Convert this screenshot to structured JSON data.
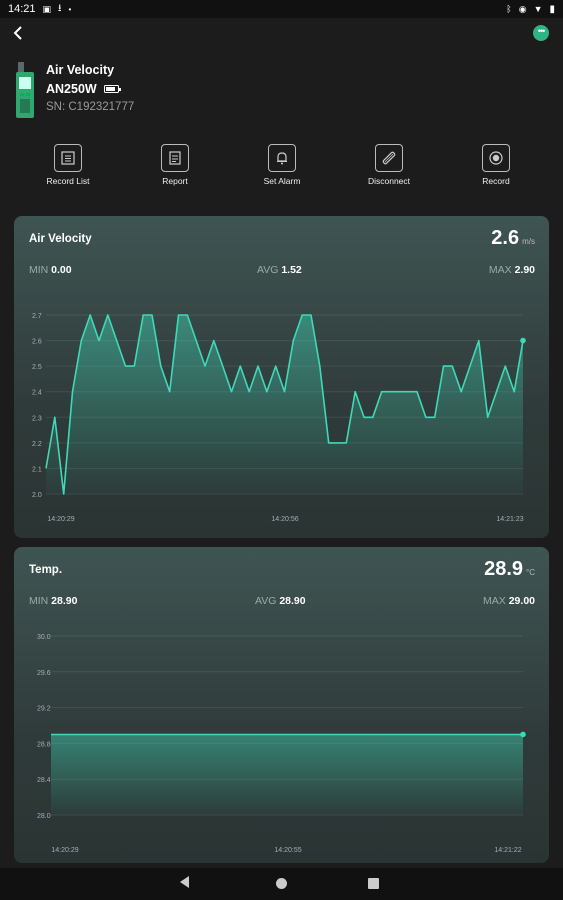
{
  "status_bar": {
    "time": "14:21"
  },
  "device": {
    "name": "Air Velocity",
    "model": "AN250W",
    "serial": "SN: C192321777"
  },
  "actions": [
    {
      "label": "Record List",
      "icon": "record-list-icon"
    },
    {
      "label": "Report",
      "icon": "report-icon"
    },
    {
      "label": "Set Alarm",
      "icon": "bell-icon"
    },
    {
      "label": "Disconnect",
      "icon": "disconnect-icon"
    },
    {
      "label": "Record",
      "icon": "record-icon"
    }
  ],
  "colors": {
    "accent": "#3fd9b8",
    "background": "#1c1c1c",
    "card": "#3a4b4a"
  },
  "cards": {
    "air": {
      "title": "Air Velocity",
      "value": "2.6",
      "unit": "m/s",
      "min_label": "MIN",
      "min": "0.00",
      "avg_label": "AVG",
      "avg": "1.52",
      "max_label": "MAX",
      "max": "2.90"
    },
    "temp": {
      "title": "Temp.",
      "value": "28.9",
      "unit": "°C",
      "min_label": "MIN",
      "min": "28.90",
      "avg_label": "AVG",
      "avg": "28.90",
      "max_label": "MAX",
      "max": "29.00"
    }
  },
  "chart_data": [
    {
      "type": "area",
      "title": "Air Velocity",
      "y_ticks": [
        "2.7",
        "2.6",
        "2.5",
        "2.4",
        "2.3",
        "2.2",
        "2.1",
        "2.0"
      ],
      "ylim": [
        2.0,
        2.7
      ],
      "x_ticks": [
        "14:20:29",
        "14:20:56",
        "14:21:23"
      ],
      "values": [
        2.1,
        2.3,
        2.0,
        2.4,
        2.6,
        2.7,
        2.6,
        2.7,
        2.6,
        2.5,
        2.5,
        2.7,
        2.7,
        2.5,
        2.4,
        2.7,
        2.7,
        2.6,
        2.5,
        2.6,
        2.5,
        2.4,
        2.5,
        2.4,
        2.5,
        2.4,
        2.5,
        2.4,
        2.6,
        2.7,
        2.7,
        2.5,
        2.2,
        2.2,
        2.2,
        2.4,
        2.3,
        2.3,
        2.4,
        2.4,
        2.4,
        2.4,
        2.4,
        2.3,
        2.3,
        2.5,
        2.5,
        2.4,
        2.5,
        2.6,
        2.3,
        2.4,
        2.5,
        2.4,
        2.6
      ],
      "grid": true
    },
    {
      "type": "area",
      "title": "Temp.",
      "y_ticks": [
        "30.0",
        "29.6",
        "29.2",
        "28.8",
        "28.4",
        "28.0"
      ],
      "ylim": [
        28.0,
        30.0
      ],
      "x_ticks": [
        "14:20:29",
        "14:20:55",
        "14:21:22"
      ],
      "values": [
        28.9,
        28.9,
        28.9,
        28.9,
        28.9,
        28.9,
        28.9,
        28.9,
        28.9,
        28.9
      ],
      "grid": true
    }
  ]
}
